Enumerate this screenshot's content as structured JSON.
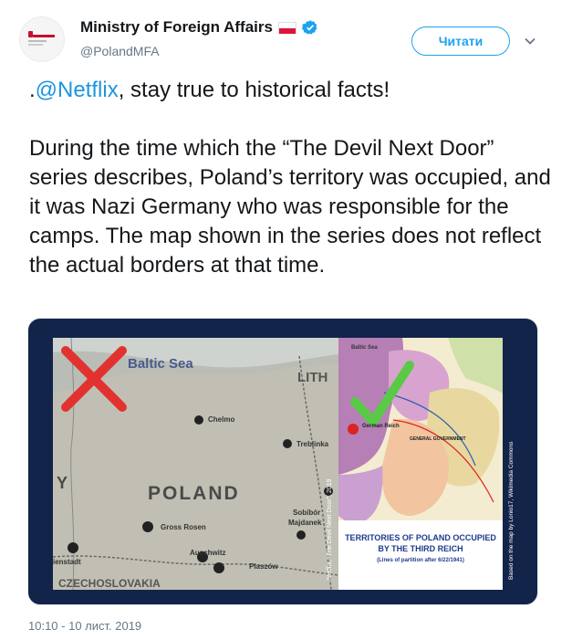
{
  "account": {
    "display_name": "Ministry of Foreign Affairs",
    "handle": "@PolandMFA",
    "flag_icon": "poland-flag-icon",
    "verified_icon": "verified-badge-icon",
    "verified_color": "#1da1f2"
  },
  "follow_button": {
    "label": "Читати"
  },
  "tweet": {
    "line1_prefix": ".",
    "mention": "@Netflix",
    "line1_suffix": ", stay true to historical facts!",
    "paragraph2": "During the time which the “The Devil Next Door” series describes, Poland’s territory was occupied, and it was Nazi Germany who was responsible for the camps. The map shown in the series does not reflect the actual borders at that time."
  },
  "media": {
    "left_map": {
      "sea_label": "Baltic Sea",
      "country_label": "POLAND",
      "lith_label": "LITH",
      "credit": "Netflix, “The Devil Next Door”, 2019",
      "places": [
        "Chelmo",
        "Treblinka",
        "Sobibór",
        "Majdanek",
        "Gross Rosen",
        "Auschwitz",
        "Plaszów",
        "ienstadt"
      ],
      "left_letter": "Y",
      "bottom_text": "CZECHOSLOVAKIA",
      "mark": "red-x-icon"
    },
    "right_map": {
      "title_line1": "TERRITORIES OF POLAND OCCUPIED",
      "title_line2": "BY THE THIRD REICH",
      "subtitle": "(Lines of partition after 6/22/1941)",
      "credit": "Based on the map by Lonio17, Wikimedia Commons",
      "german_reich_label": "German Reich",
      "general_government_label": "GENERAL GOVERNMENT",
      "baltic_label": "Baltic Sea",
      "mark": "green-check-icon"
    }
  },
  "timestamp": "10:10 - 10 лист. 2019"
}
